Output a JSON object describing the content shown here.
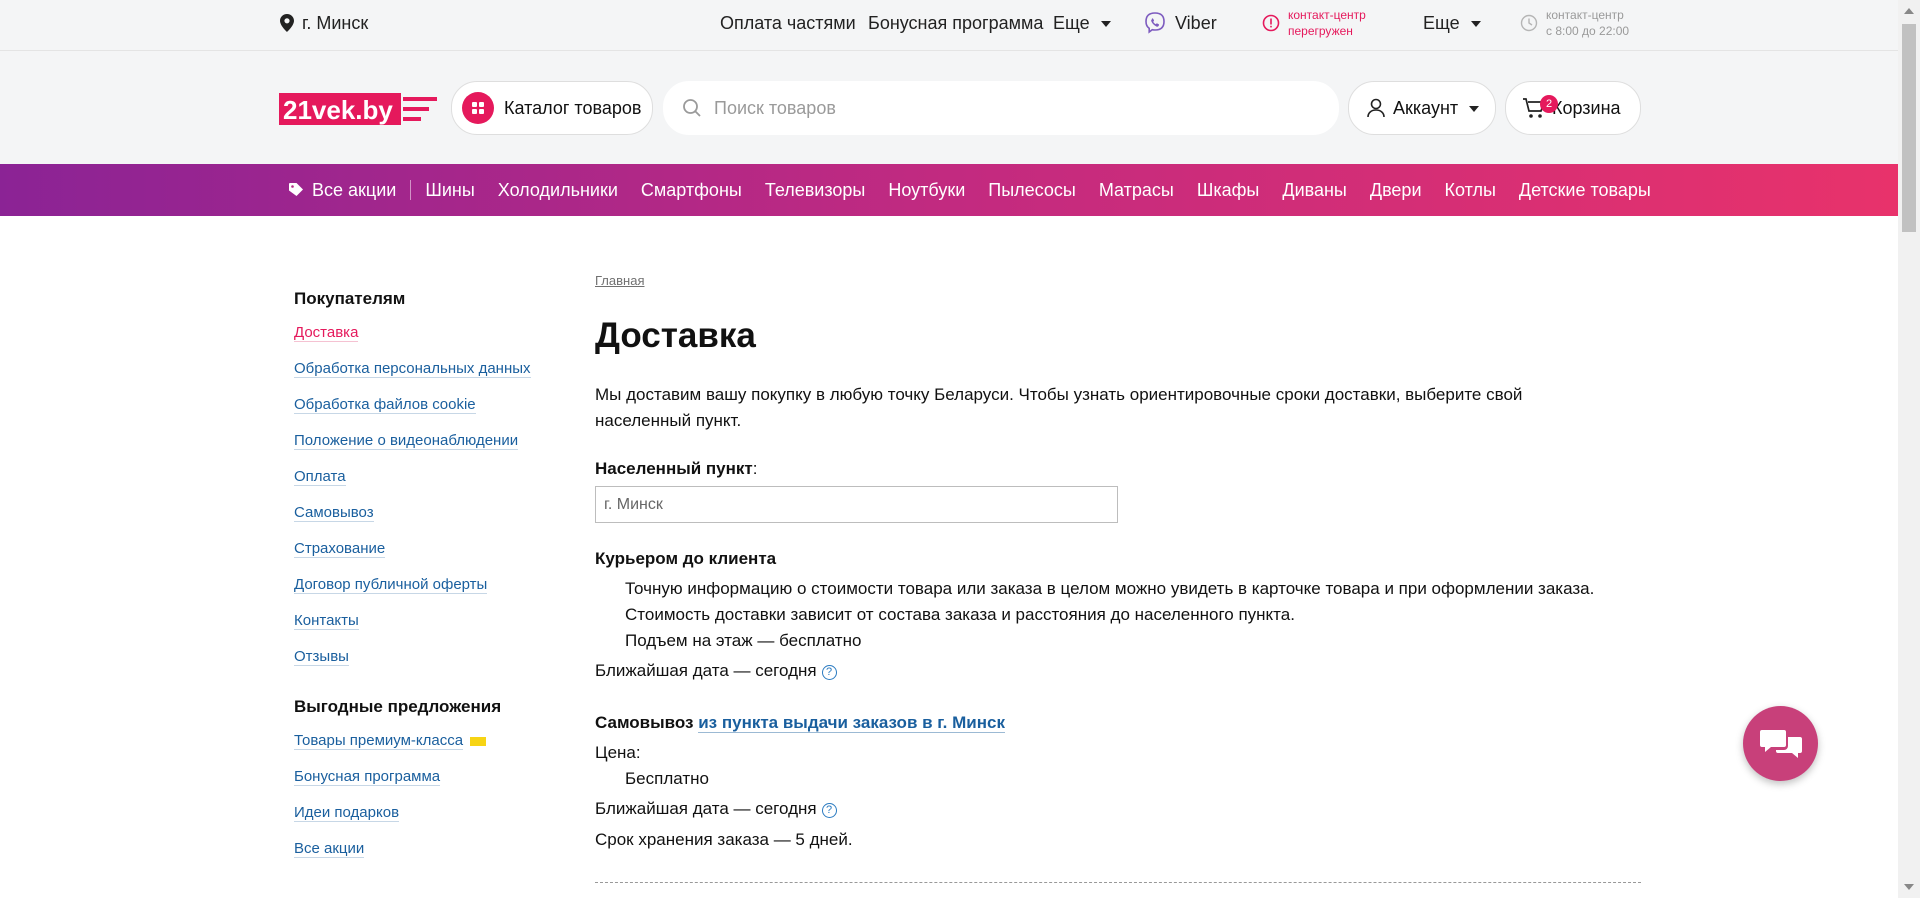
{
  "topbar": {
    "city": "г. Минск",
    "pay_parts": "Оплата частями",
    "bonus_program": "Бонусная программа",
    "more1": "Еще",
    "viber": "Viber",
    "contact_center_line1": "контакт-центр",
    "contact_center_line2": "перегружен",
    "more2": "Еще",
    "hours_line1": "контакт-центр",
    "hours_line2": "с 8:00 до 22:00"
  },
  "header": {
    "logo_text": "21vek.by",
    "catalog_label": "Каталог товаров",
    "search_placeholder": "Поиск товаров",
    "account_label": "Аккаунт",
    "cart_label": "Корзина",
    "cart_count": "2"
  },
  "promo_nav": {
    "all_promos": "Все акции",
    "items": [
      "Шины",
      "Холодильники",
      "Смартфоны",
      "Телевизоры",
      "Ноутбуки",
      "Пылесосы",
      "Матрасы",
      "Шкафы",
      "Диваны",
      "Двери",
      "Котлы",
      "Детские товары"
    ]
  },
  "sidebar": {
    "section1_title": "Покупателям",
    "section1_items": [
      "Доставка",
      "Обработка персональных данных",
      "Обработка файлов cookie",
      "Положение о видеонаблюдении",
      "Оплата",
      "Самовывоз",
      "Страхование",
      "Договор публичной оферты",
      "Контакты",
      "Отзывы"
    ],
    "section2_title": "Выгодные предложения",
    "section2_items": [
      "Товары премиум-класса",
      "Бонусная программа",
      "Идеи подарков",
      "Все акции"
    ]
  },
  "main": {
    "breadcrumb": "Главная",
    "title": "Доставка",
    "intro": "Мы доставим вашу покупку в любую точку Беларуси. Чтобы узнать ориентировочные сроки доставки, выберите свой населенный пункт.",
    "locality_label": "Населенный пункт",
    "locality_colon": ":",
    "locality_value": "г. Минск",
    "courier_title": "Курьером до клиента",
    "courier_line1": "Точную информацию о стоимости товара или заказа в целом можно увидеть в карточке товара и при оформлении заказа.",
    "courier_line2": "Стоимость доставки зависит от состава заказа и расстояния до населенного пункта.",
    "courier_line3": "Подъем на этаж — бесплатно",
    "courier_nearest": "Ближайшая дата — сегодня",
    "pickup_title": "Самовывоз",
    "pickup_link": "из пункта выдачи заказов в г. Минск",
    "pickup_price_label": "Цена:",
    "pickup_price": "Бесплатно",
    "pickup_nearest": "Ближайшая дата — сегодня",
    "pickup_storage": "Срок хранения заказа — 5 дней."
  },
  "colors": {
    "brand_pink": "#e5195c",
    "link_blue": "#1a5f9e",
    "nav_gradient_start": "#8b2395",
    "nav_gradient_end": "#e8326b",
    "chat_button": "#c8407a"
  }
}
